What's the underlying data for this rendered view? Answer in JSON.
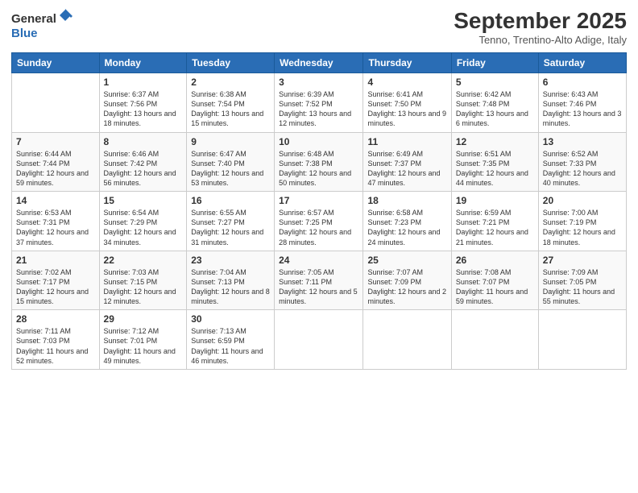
{
  "logo": {
    "text1": "General",
    "text2": "Blue"
  },
  "title": "September 2025",
  "location": "Tenno, Trentino-Alto Adige, Italy",
  "days_of_week": [
    "Sunday",
    "Monday",
    "Tuesday",
    "Wednesday",
    "Thursday",
    "Friday",
    "Saturday"
  ],
  "weeks": [
    [
      null,
      {
        "date": "1",
        "sunrise": "Sunrise: 6:37 AM",
        "sunset": "Sunset: 7:56 PM",
        "daylight": "Daylight: 13 hours and 18 minutes."
      },
      {
        "date": "2",
        "sunrise": "Sunrise: 6:38 AM",
        "sunset": "Sunset: 7:54 PM",
        "daylight": "Daylight: 13 hours and 15 minutes."
      },
      {
        "date": "3",
        "sunrise": "Sunrise: 6:39 AM",
        "sunset": "Sunset: 7:52 PM",
        "daylight": "Daylight: 13 hours and 12 minutes."
      },
      {
        "date": "4",
        "sunrise": "Sunrise: 6:41 AM",
        "sunset": "Sunset: 7:50 PM",
        "daylight": "Daylight: 13 hours and 9 minutes."
      },
      {
        "date": "5",
        "sunrise": "Sunrise: 6:42 AM",
        "sunset": "Sunset: 7:48 PM",
        "daylight": "Daylight: 13 hours and 6 minutes."
      },
      {
        "date": "6",
        "sunrise": "Sunrise: 6:43 AM",
        "sunset": "Sunset: 7:46 PM",
        "daylight": "Daylight: 13 hours and 3 minutes."
      }
    ],
    [
      {
        "date": "7",
        "sunrise": "Sunrise: 6:44 AM",
        "sunset": "Sunset: 7:44 PM",
        "daylight": "Daylight: 12 hours and 59 minutes."
      },
      {
        "date": "8",
        "sunrise": "Sunrise: 6:46 AM",
        "sunset": "Sunset: 7:42 PM",
        "daylight": "Daylight: 12 hours and 56 minutes."
      },
      {
        "date": "9",
        "sunrise": "Sunrise: 6:47 AM",
        "sunset": "Sunset: 7:40 PM",
        "daylight": "Daylight: 12 hours and 53 minutes."
      },
      {
        "date": "10",
        "sunrise": "Sunrise: 6:48 AM",
        "sunset": "Sunset: 7:38 PM",
        "daylight": "Daylight: 12 hours and 50 minutes."
      },
      {
        "date": "11",
        "sunrise": "Sunrise: 6:49 AM",
        "sunset": "Sunset: 7:37 PM",
        "daylight": "Daylight: 12 hours and 47 minutes."
      },
      {
        "date": "12",
        "sunrise": "Sunrise: 6:51 AM",
        "sunset": "Sunset: 7:35 PM",
        "daylight": "Daylight: 12 hours and 44 minutes."
      },
      {
        "date": "13",
        "sunrise": "Sunrise: 6:52 AM",
        "sunset": "Sunset: 7:33 PM",
        "daylight": "Daylight: 12 hours and 40 minutes."
      }
    ],
    [
      {
        "date": "14",
        "sunrise": "Sunrise: 6:53 AM",
        "sunset": "Sunset: 7:31 PM",
        "daylight": "Daylight: 12 hours and 37 minutes."
      },
      {
        "date": "15",
        "sunrise": "Sunrise: 6:54 AM",
        "sunset": "Sunset: 7:29 PM",
        "daylight": "Daylight: 12 hours and 34 minutes."
      },
      {
        "date": "16",
        "sunrise": "Sunrise: 6:55 AM",
        "sunset": "Sunset: 7:27 PM",
        "daylight": "Daylight: 12 hours and 31 minutes."
      },
      {
        "date": "17",
        "sunrise": "Sunrise: 6:57 AM",
        "sunset": "Sunset: 7:25 PM",
        "daylight": "Daylight: 12 hours and 28 minutes."
      },
      {
        "date": "18",
        "sunrise": "Sunrise: 6:58 AM",
        "sunset": "Sunset: 7:23 PM",
        "daylight": "Daylight: 12 hours and 24 minutes."
      },
      {
        "date": "19",
        "sunrise": "Sunrise: 6:59 AM",
        "sunset": "Sunset: 7:21 PM",
        "daylight": "Daylight: 12 hours and 21 minutes."
      },
      {
        "date": "20",
        "sunrise": "Sunrise: 7:00 AM",
        "sunset": "Sunset: 7:19 PM",
        "daylight": "Daylight: 12 hours and 18 minutes."
      }
    ],
    [
      {
        "date": "21",
        "sunrise": "Sunrise: 7:02 AM",
        "sunset": "Sunset: 7:17 PM",
        "daylight": "Daylight: 12 hours and 15 minutes."
      },
      {
        "date": "22",
        "sunrise": "Sunrise: 7:03 AM",
        "sunset": "Sunset: 7:15 PM",
        "daylight": "Daylight: 12 hours and 12 minutes."
      },
      {
        "date": "23",
        "sunrise": "Sunrise: 7:04 AM",
        "sunset": "Sunset: 7:13 PM",
        "daylight": "Daylight: 12 hours and 8 minutes."
      },
      {
        "date": "24",
        "sunrise": "Sunrise: 7:05 AM",
        "sunset": "Sunset: 7:11 PM",
        "daylight": "Daylight: 12 hours and 5 minutes."
      },
      {
        "date": "25",
        "sunrise": "Sunrise: 7:07 AM",
        "sunset": "Sunset: 7:09 PM",
        "daylight": "Daylight: 12 hours and 2 minutes."
      },
      {
        "date": "26",
        "sunrise": "Sunrise: 7:08 AM",
        "sunset": "Sunset: 7:07 PM",
        "daylight": "Daylight: 11 hours and 59 minutes."
      },
      {
        "date": "27",
        "sunrise": "Sunrise: 7:09 AM",
        "sunset": "Sunset: 7:05 PM",
        "daylight": "Daylight: 11 hours and 55 minutes."
      }
    ],
    [
      {
        "date": "28",
        "sunrise": "Sunrise: 7:11 AM",
        "sunset": "Sunset: 7:03 PM",
        "daylight": "Daylight: 11 hours and 52 minutes."
      },
      {
        "date": "29",
        "sunrise": "Sunrise: 7:12 AM",
        "sunset": "Sunset: 7:01 PM",
        "daylight": "Daylight: 11 hours and 49 minutes."
      },
      {
        "date": "30",
        "sunrise": "Sunrise: 7:13 AM",
        "sunset": "Sunset: 6:59 PM",
        "daylight": "Daylight: 11 hours and 46 minutes."
      },
      null,
      null,
      null,
      null
    ]
  ]
}
